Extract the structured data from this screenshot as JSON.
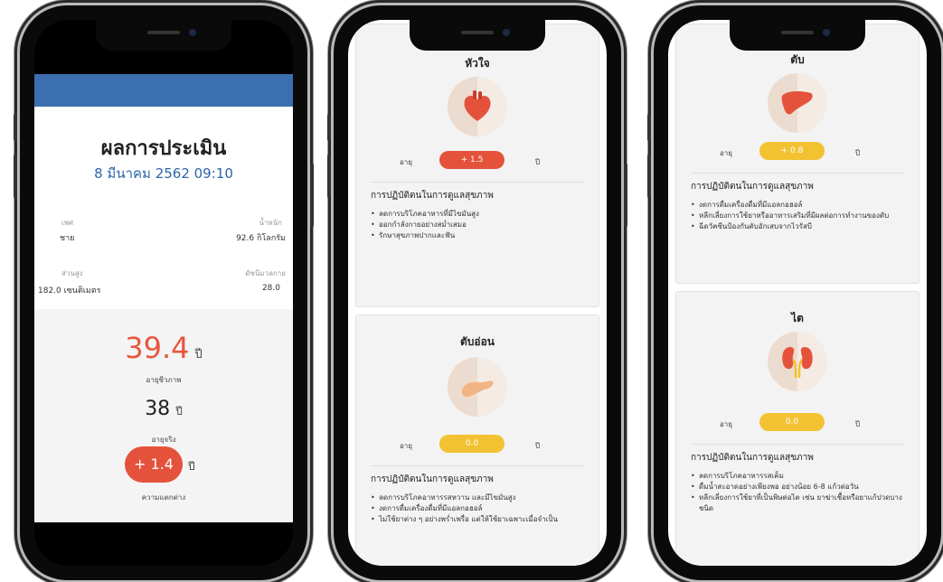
{
  "phone1": {
    "title": "ผลการประเมิน",
    "date": "8 มีนาคม 2562 09:10",
    "sex_label": "เพศ",
    "sex_value": "ชาย",
    "weight_label": "น้ำหนัก",
    "weight_value": "92.6 กิโลกรัม",
    "height_label": "ส่วนสูง",
    "height_value": "182.0 เซนติเมตร",
    "bmi_label": "ดัชนีมวลกาย",
    "bmi_value": "28.0",
    "bio_age": "39.4",
    "year_unit": "ปี",
    "bio_age_label": "อายุชีวภาพ",
    "real_age": "38",
    "real_age_label": "อายุจริง",
    "difference": "+ 1.4",
    "difference_label": "ความแตกต่าง",
    "colors": {
      "header_bar": "#3b6fb0",
      "accent": "#e8563f",
      "date": "#2a66a9"
    }
  },
  "phone2": {
    "card1": {
      "title": "หัวใจ",
      "icon": "heart-icon",
      "age_label": "อายุ",
      "age_value": "+ 1.5",
      "unit": "ปี",
      "section_title": "การปฏิบัติตนในการดูแลสุขภาพ",
      "bullets": [
        "ลดการบริโภคอาหารที่มีไขมันสูง",
        "ออกกำลังกายอย่างสม่ำเสมอ",
        "รักษาสุขภาพปากและฟัน"
      ]
    },
    "card2": {
      "title": "ตับอ่อน",
      "icon": "pancreas-icon",
      "age_label": "อายุ",
      "age_value": "0.0",
      "unit": "ปี",
      "section_title": "การปฏิบัติตนในการดูแลสุขภาพ",
      "bullets": [
        "ลดการบริโภคอาหารรสหวาน และมีไขมันสูง",
        "งดการดื่มเครื่องดื่มที่มีแอลกอฮอล์",
        "ไม่ใช้ยาต่าง ๆ อย่างพร่ำเพรื่อ แต่ให้ใช้ยาเฉพาะเมื่อจำเป็น"
      ]
    }
  },
  "phone3": {
    "card1": {
      "title": "ตับ",
      "icon": "liver-icon",
      "age_label": "อายุ",
      "age_value": "+ 0.8",
      "unit": "ปี",
      "section_title": "การปฏิบัติตนในการดูแลสุขภาพ",
      "bullets": [
        "งดการดื่มเครื่องดื่มที่มีแอลกอฮอล์",
        "หลีกเลี่ยงการใช้ยาหรืออาหารเสริมที่มีผลต่อการทำงานของตับ",
        "ฉีดวัคซีนป้องกันตับอักเสบจากไวรัสบี"
      ]
    },
    "card2": {
      "title": "ไต",
      "icon": "kidney-icon",
      "age_label": "อายุ",
      "age_value": "0.0",
      "unit": "ปี",
      "section_title": "การปฏิบัติตนในการดูแลสุขภาพ",
      "bullets": [
        "ลดการบริโภคอาหารรสเค็ม",
        "ดื่มน้ำสะอาดอย่างเพียงพอ อย่างน้อย 6-8 แก้วต่อวัน",
        "หลีกเลี่ยงการใช้ยาที่เป็นพิษต่อไต เช่น ยาฆ่าเชื้อหรือยาแก้ปวดบางชนิด"
      ]
    }
  }
}
